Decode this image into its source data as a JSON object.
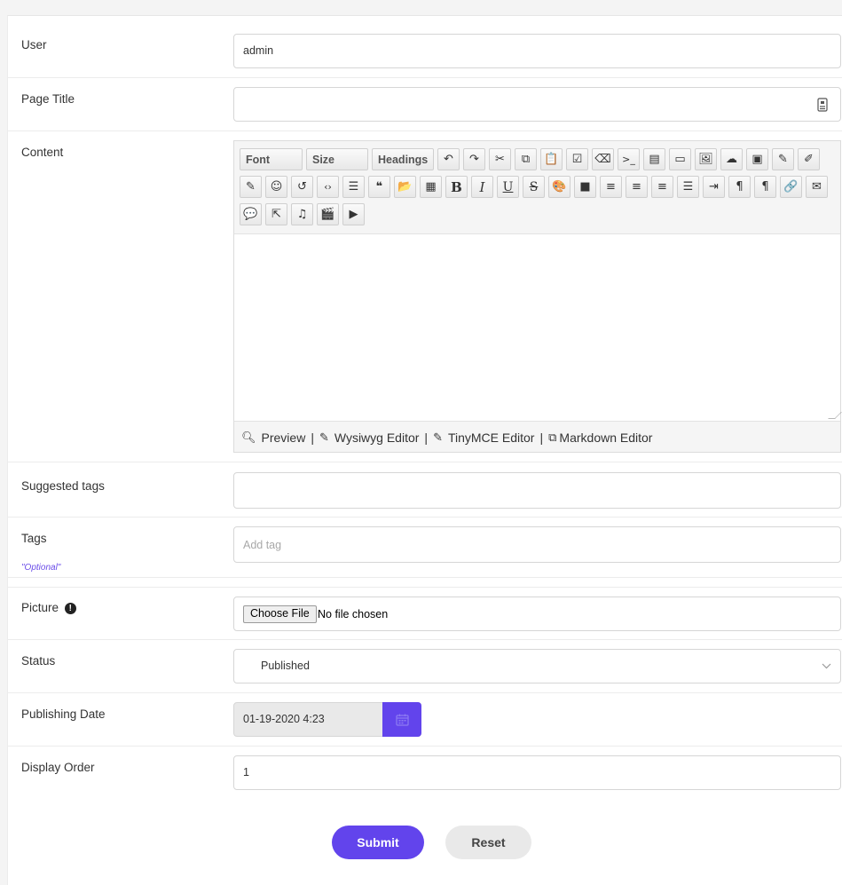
{
  "form": {
    "user": {
      "label": "User",
      "value": "admin"
    },
    "page_title": {
      "label": "Page Title",
      "value": ""
    },
    "content": {
      "label": "Content",
      "toolbar": {
        "font": "Font",
        "size": "Size",
        "headings": "Headings"
      },
      "footer": {
        "preview": "Preview",
        "wysiwyg": "Wysiwyg Editor",
        "tinymce": "TinyMCE Editor",
        "markdown": "Markdown Editor",
        "separator": "|"
      }
    },
    "suggested_tags": {
      "label": "Suggested tags",
      "value": ""
    },
    "tags": {
      "label": "Tags",
      "optional": "\"Optional\"",
      "placeholder": "Add tag"
    },
    "picture": {
      "label": "Picture",
      "button": "Choose File",
      "status": "No file chosen"
    },
    "status": {
      "label": "Status",
      "value": "Published"
    },
    "publishing_date": {
      "label": "Publishing Date",
      "value": "01-19-2020 4:23"
    },
    "display_order": {
      "label": "Display Order",
      "value": "1"
    }
  },
  "buttons": {
    "submit": "Submit",
    "reset": "Reset"
  },
  "colors": {
    "accent": "#6244ec",
    "optional_text": "#6a4ce8"
  }
}
